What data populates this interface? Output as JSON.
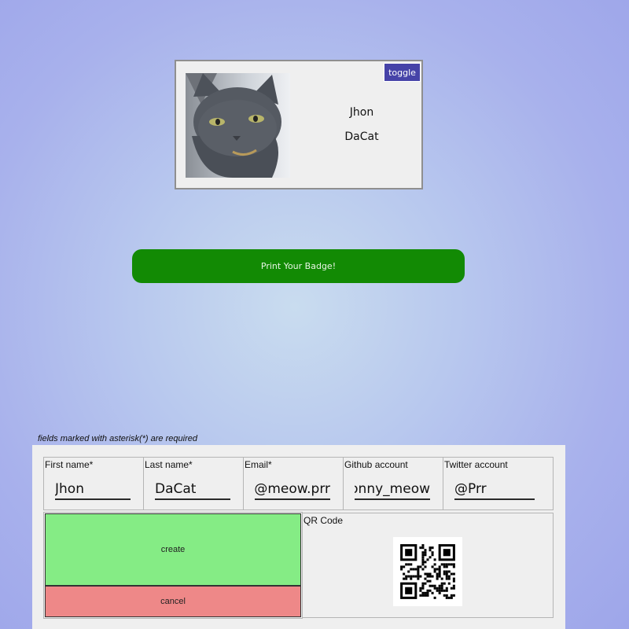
{
  "badge": {
    "toggle_label": "toggle",
    "first_name": "Jhon",
    "last_name": "DaCat",
    "photo_icon": "cat-photo"
  },
  "print_button": {
    "label": "Print Your Badge!"
  },
  "form": {
    "required_note": "fields marked with asterisk(*) are required",
    "fields": [
      {
        "label": "First name*",
        "value": "Jhon"
      },
      {
        "label": "Last name*",
        "value": "DaCat"
      },
      {
        "label": "Email*",
        "value": "jhon@meow.prr"
      },
      {
        "label": "Github account",
        "value": "jonny_meow"
      },
      {
        "label": "Twitter account",
        "value": "@Prr"
      }
    ],
    "create_label": "create",
    "cancel_label": "cancel",
    "qr_label": "QR Code",
    "qr_icon": "qr-code"
  },
  "colors": {
    "print_button": "#128a04",
    "toggle_button": "#4643a8",
    "create_button": "#85ec85",
    "cancel_button": "#ee8888"
  }
}
